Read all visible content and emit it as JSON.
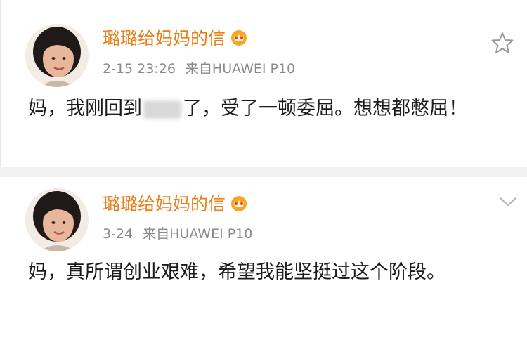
{
  "posts": [
    {
      "username": "璐璐给妈妈的信",
      "time": "2-15 23:26",
      "source": "来自HUAWEI P10",
      "content_before": "妈，我刚回到",
      "content_after": "了，受了一顿委屈。想想都憋屈！",
      "action_icon": "star-icon"
    },
    {
      "username": "璐璐给妈妈的信",
      "time": "3-24",
      "source": "来自HUAWEI P10",
      "content": "妈，真所谓创业艰难，希望我能坚挺过这个阶段。",
      "action_icon": "chevron-down-icon"
    }
  ],
  "colors": {
    "username": "#e8801a",
    "meta": "#8a8a8a",
    "text": "#1a1a1a",
    "separator": "#f2f2f2"
  }
}
